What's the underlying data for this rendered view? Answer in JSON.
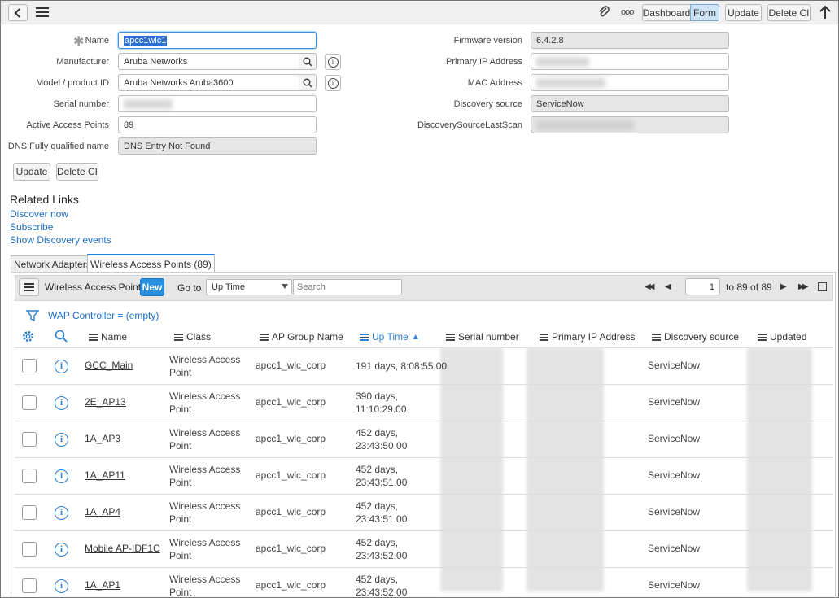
{
  "header": {
    "update_label": "Update",
    "delete_label": "Delete CI",
    "dashboard_label": "Dashboard",
    "form_label": "Form",
    "more_label": "ooo"
  },
  "form": {
    "name_label": "Name",
    "name_value": "apcc1wlc1",
    "manufacturer_label": "Manufacturer",
    "manufacturer_value": "Aruba Networks",
    "model_label": "Model / product ID",
    "model_value": "Aruba Networks Aruba3600",
    "serial_label": "Serial number",
    "serial_value": "",
    "active_ap_label": "Active Access Points",
    "active_ap_value": "89",
    "dns_label": "DNS Fully qualified name",
    "dns_value": "DNS Entry Not Found",
    "firmware_label": "Firmware version",
    "firmware_value": "6.4.2.8",
    "primary_ip_label": "Primary IP Address",
    "primary_ip_value": "",
    "mac_label": "MAC Address",
    "mac_value": "",
    "discovery_source_label": "Discovery source",
    "discovery_source_value": "ServiceNow",
    "last_scan_label": "DiscoverySourceLastScan",
    "last_scan_value": "",
    "update_label": "Update",
    "delete_label": "Delete CI"
  },
  "related": {
    "title": "Related Links",
    "links": [
      "Discover now",
      "Subscribe",
      "Show Discovery events"
    ]
  },
  "tabs": [
    "Network Adapters",
    "Wireless Access Points (89)"
  ],
  "list": {
    "title": "Wireless Access Points",
    "new_label": "New",
    "goto_label": "Go to",
    "goto_select": "Up Time",
    "search_placeholder": "Search",
    "page_value": "1",
    "page_info": "to 89 of 89",
    "filter_text": "WAP Controller = (empty)",
    "columns": [
      "Name",
      "Class",
      "AP Group Name",
      "Up Time",
      "Serial number",
      "Primary IP Address",
      "Discovery source",
      "Updated"
    ],
    "sort_column": "Up Time",
    "rows": [
      {
        "name": "GCC_Main",
        "class": "Wireless Access Point",
        "group": "apcc1_wlc_corp",
        "uptime": "191 days, 8:08:55.00",
        "source": "ServiceNow"
      },
      {
        "name": "2E_AP13",
        "class": "Wireless Access Point",
        "group": "apcc1_wlc_corp",
        "uptime": "390 days, 11:10:29.00",
        "source": "ServiceNow"
      },
      {
        "name": "1A_AP3",
        "class": "Wireless Access Point",
        "group": "apcc1_wlc_corp",
        "uptime": "452 days, 23:43:50.00",
        "source": "ServiceNow"
      },
      {
        "name": "1A_AP11",
        "class": "Wireless Access Point",
        "group": "apcc1_wlc_corp",
        "uptime": "452 days, 23:43:51.00",
        "source": "ServiceNow"
      },
      {
        "name": "1A_AP4",
        "class": "Wireless Access Point",
        "group": "apcc1_wlc_corp",
        "uptime": "452 days, 23:43:51.00",
        "source": "ServiceNow"
      },
      {
        "name": "Mobile AP-IDF1C",
        "class": "Wireless Access Point",
        "group": "apcc1_wlc_corp",
        "uptime": "452 days, 23:43:52.00",
        "source": "ServiceNow"
      },
      {
        "name": "1A_AP1",
        "class": "Wireless Access Point",
        "group": "apcc1_wlc_corp",
        "uptime": "452 days, 23:43:52.00",
        "source": "ServiceNow"
      }
    ]
  },
  "colors": {
    "accent": "#1d6ec5",
    "new_button": "#2a8fe0",
    "header_bg": "#f0f0f0"
  }
}
